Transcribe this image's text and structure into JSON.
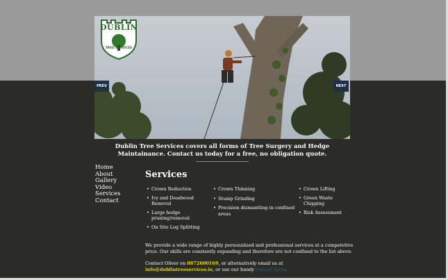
{
  "logo": {
    "line1": "DUBLIN",
    "line2": "TREE SERVICES"
  },
  "slider": {
    "prev_label": "PREV",
    "next_label": "NEXT"
  },
  "intro": {
    "text": "Dublin Tree Services covers all forms of  Tree Surgery and Hedge Maintainance. Contact us today for a free, no obligation quote."
  },
  "nav": {
    "items": [
      "Home",
      "About",
      "Gallery",
      "Video",
      "Services",
      "Contact"
    ]
  },
  "services": {
    "heading": "Services",
    "col1": [
      "Crown Reduction",
      "Ivy and Deadwood Removal",
      "Large hedge pruning/removal",
      "On Site Log Splitting"
    ],
    "col2": [
      "Crown Thinning",
      "Stump Grinding",
      "Precision dismantling in confined areas"
    ],
    "col3": [
      "Crown Lifting",
      "Green Waste Chipping",
      "Risk Assessment"
    ]
  },
  "para": "We provide a wide range of highly personalised and professional services at a competetive price. Our skills are constantly expanding and therefore are not confined to the list above.",
  "contact": {
    "prefix": "Contact Oliver on ",
    "phone": "0872600169",
    "middle": ", or alternatively email us at",
    "email": "info@dublintreeservices.ie",
    "middle2": ", or use our handy ",
    "form_link": "contact form",
    "suffix": "."
  },
  "colors": {
    "background": "#2b2b27",
    "topband": "#9a9a9a",
    "highlight": "#e8d800",
    "nav_button": "#1f2f45"
  }
}
